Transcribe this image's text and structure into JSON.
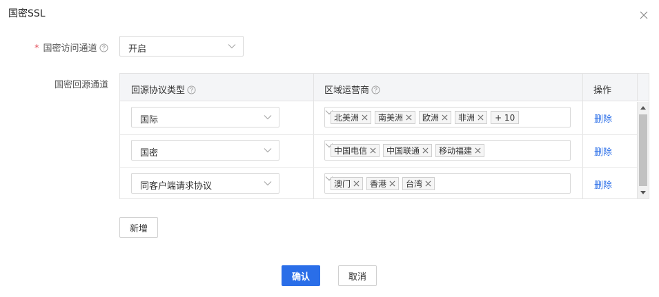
{
  "dialog": {
    "title": "国密SSL"
  },
  "form": {
    "access_channel": {
      "label": "国密访问通道",
      "required_mark": "*",
      "value": "开启"
    },
    "origin_channel": {
      "label": "国密回源通道"
    }
  },
  "table": {
    "headers": {
      "protocol": "回源协议类型",
      "region": "区域运营商",
      "action": "操作"
    },
    "rows": [
      {
        "protocol": "国际",
        "tags": [
          "北美洲",
          "南美洲",
          "欧洲",
          "非洲"
        ],
        "more": "+ 10",
        "action": "删除"
      },
      {
        "protocol": "国密",
        "tags": [
          "中国电信",
          "中国联通",
          "移动福建"
        ],
        "action": "删除"
      },
      {
        "protocol": "同客户端请求协议",
        "tags": [
          "澳门",
          "香港",
          "台湾"
        ],
        "action": "删除"
      }
    ]
  },
  "buttons": {
    "add": "新增",
    "confirm": "确认",
    "cancel": "取消"
  },
  "colors": {
    "primary": "#2a6ee8",
    "required": "#e34d59"
  },
  "icons": {
    "close": "close-icon",
    "help": "help-circle-icon",
    "dropdown": "chevron-down-icon",
    "tag_remove": "tag-close-icon"
  }
}
